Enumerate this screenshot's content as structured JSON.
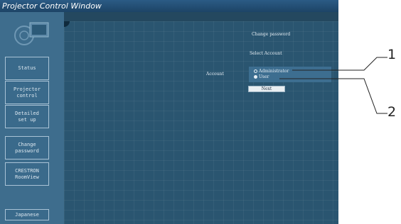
{
  "window": {
    "title": "Projector Control Window"
  },
  "sidebar": {
    "items": [
      {
        "label": "Status"
      },
      {
        "label": "Projector\ncontrol"
      },
      {
        "label": "Detailed\nset up"
      },
      {
        "label": "Change\npassword"
      },
      {
        "label": "CRESTRON\nRoomView"
      }
    ],
    "language_button": "Japanese"
  },
  "main": {
    "heading": "Change password",
    "subheading": "Select Account",
    "account_label": "Account",
    "options": [
      {
        "label": "Administrator",
        "selected": false
      },
      {
        "label": "User",
        "selected": true
      }
    ],
    "next_button": "Next"
  },
  "callouts": [
    "1",
    "2"
  ],
  "colors": {
    "window_bg": "#2d5470",
    "titlebar": "#1d4466",
    "sidebar": "#3e6d8d"
  }
}
